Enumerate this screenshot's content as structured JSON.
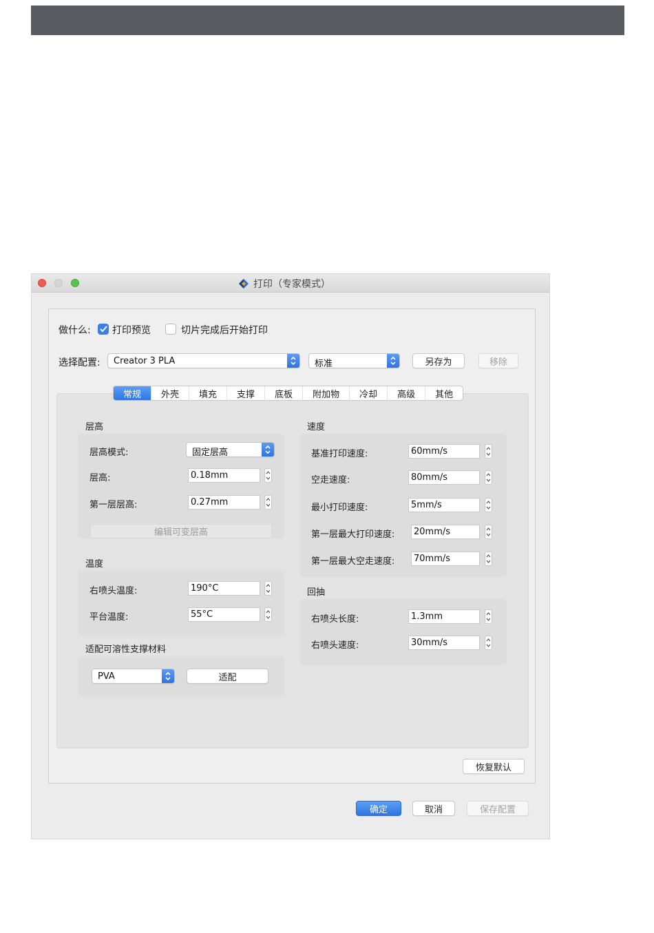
{
  "window": {
    "title": "打印（专家模式）"
  },
  "what": {
    "label": "做什么:",
    "preview_label": "打印预览",
    "preview_checked": true,
    "print_after_label": "切片完成后开始打印",
    "print_after_checked": false
  },
  "config": {
    "label": "选择配置:",
    "profile_value": "Creator 3 PLA",
    "quality_value": "标准",
    "save_as_label": "另存为",
    "remove_label": "移除"
  },
  "tabs": [
    {
      "label": "常规",
      "active": true
    },
    {
      "label": "外壳",
      "active": false
    },
    {
      "label": "填充",
      "active": false
    },
    {
      "label": "支撑",
      "active": false
    },
    {
      "label": "底板",
      "active": false
    },
    {
      "label": "附加物",
      "active": false
    },
    {
      "label": "冷却",
      "active": false
    },
    {
      "label": "高级",
      "active": false
    },
    {
      "label": "其他",
      "active": false
    }
  ],
  "layer_height": {
    "title": "层高",
    "mode_label": "层高模式:",
    "mode_value": "固定层高",
    "height_label": "层高:",
    "height_value": "0.18mm",
    "first_label": "第一层层高:",
    "first_value": "0.27mm",
    "edit_variable_label": "编辑可变层高"
  },
  "temperature": {
    "title": "温度",
    "right_nozzle_label": "右喷头温度:",
    "right_nozzle_value": "190°C",
    "platform_label": "平台温度:",
    "platform_value": "55°C"
  },
  "soluble_support": {
    "title": "适配可溶性支撑材料",
    "material_value": "PVA",
    "apply_label": "适配"
  },
  "speed": {
    "title": "速度",
    "base_label": "基准打印速度:",
    "base_value": "60mm/s",
    "travel_label": "空走速度:",
    "travel_value": "80mm/s",
    "min_label": "最小打印速度:",
    "min_value": "5mm/s",
    "first_max_print_label": "第一层最大打印速度:",
    "first_max_print_value": "20mm/s",
    "first_max_travel_label": "第一层最大空走速度:",
    "first_max_travel_value": "70mm/s"
  },
  "retraction": {
    "title": "回抽",
    "length_label": "右喷头长度:",
    "length_value": "1.3mm",
    "speed_label": "右喷头速度:",
    "speed_value": "30mm/s"
  },
  "footer": {
    "restore_default_label": "恢复默认",
    "ok_label": "确定",
    "cancel_label": "取消",
    "save_config_label": "保存配置"
  },
  "colors": {
    "accent": "#2f74e0",
    "header_bar": "#5a5b60",
    "close": "#ee5b55",
    "maximize": "#5ac24c"
  }
}
